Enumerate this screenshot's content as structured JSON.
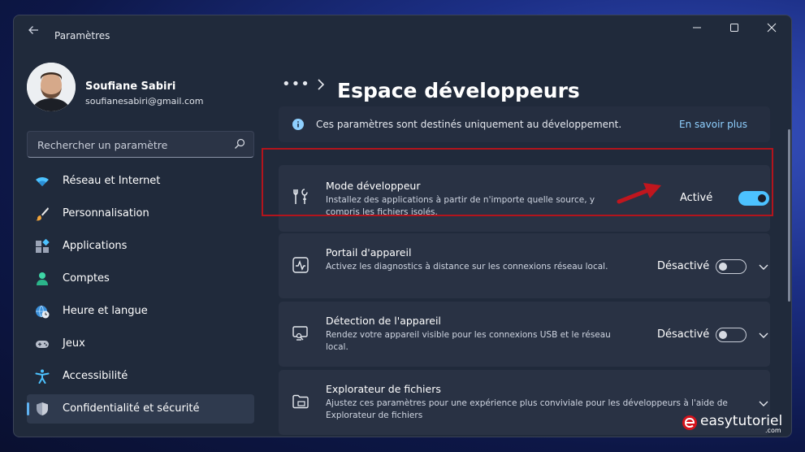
{
  "window": {
    "title": "Paramètres"
  },
  "user": {
    "name": "Soufiane Sabiri",
    "email": "soufianesabiri@gmail.com"
  },
  "search": {
    "placeholder": "Rechercher un paramètre"
  },
  "sidebar": {
    "items": [
      {
        "label": "Réseau et Internet",
        "icon": "wifi-icon"
      },
      {
        "label": "Personnalisation",
        "icon": "brush-icon"
      },
      {
        "label": "Applications",
        "icon": "apps-icon"
      },
      {
        "label": "Comptes",
        "icon": "person-icon"
      },
      {
        "label": "Heure et langue",
        "icon": "globe-clock-icon"
      },
      {
        "label": "Jeux",
        "icon": "gamepad-icon"
      },
      {
        "label": "Accessibilité",
        "icon": "accessibility-icon"
      },
      {
        "label": "Confidentialité et sécurité",
        "icon": "shield-icon",
        "active": true
      }
    ]
  },
  "header": {
    "breadcrumb_more": "•••",
    "title": "Espace développeurs"
  },
  "info_banner": {
    "text": "Ces paramètres sont destinés uniquement au développement.",
    "link": "En savoir plus"
  },
  "settings": [
    {
      "title": "Mode développeur",
      "description": "Installez des applications à partir de n'importe quelle source, y compris les fichiers isolés.",
      "state": "Activé",
      "on": true,
      "icon": "tools-icon"
    },
    {
      "title": "Portail d'appareil",
      "description": "Activez les diagnostics à distance sur les connexions réseau local.",
      "state": "Désactivé",
      "on": false,
      "icon": "pulse-icon"
    },
    {
      "title": "Détection de l'appareil",
      "description": "Rendez votre appareil visible pour les connexions USB et le réseau local.",
      "state": "Désactivé",
      "on": false,
      "icon": "device-search-icon"
    },
    {
      "title": "Explorateur de fichiers",
      "description": "Ajustez ces paramètres pour une expérience plus conviviale pour les développeurs à l'aide de Explorateur de fichiers",
      "icon": "folder-icon"
    }
  ],
  "watermark": {
    "text": "easytutoriel",
    "suffix": ".com"
  },
  "colors": {
    "accent": "#4cc2ff",
    "highlight": "#b3141c",
    "window_bg": "#202a3b",
    "card_bg": "#293244"
  }
}
